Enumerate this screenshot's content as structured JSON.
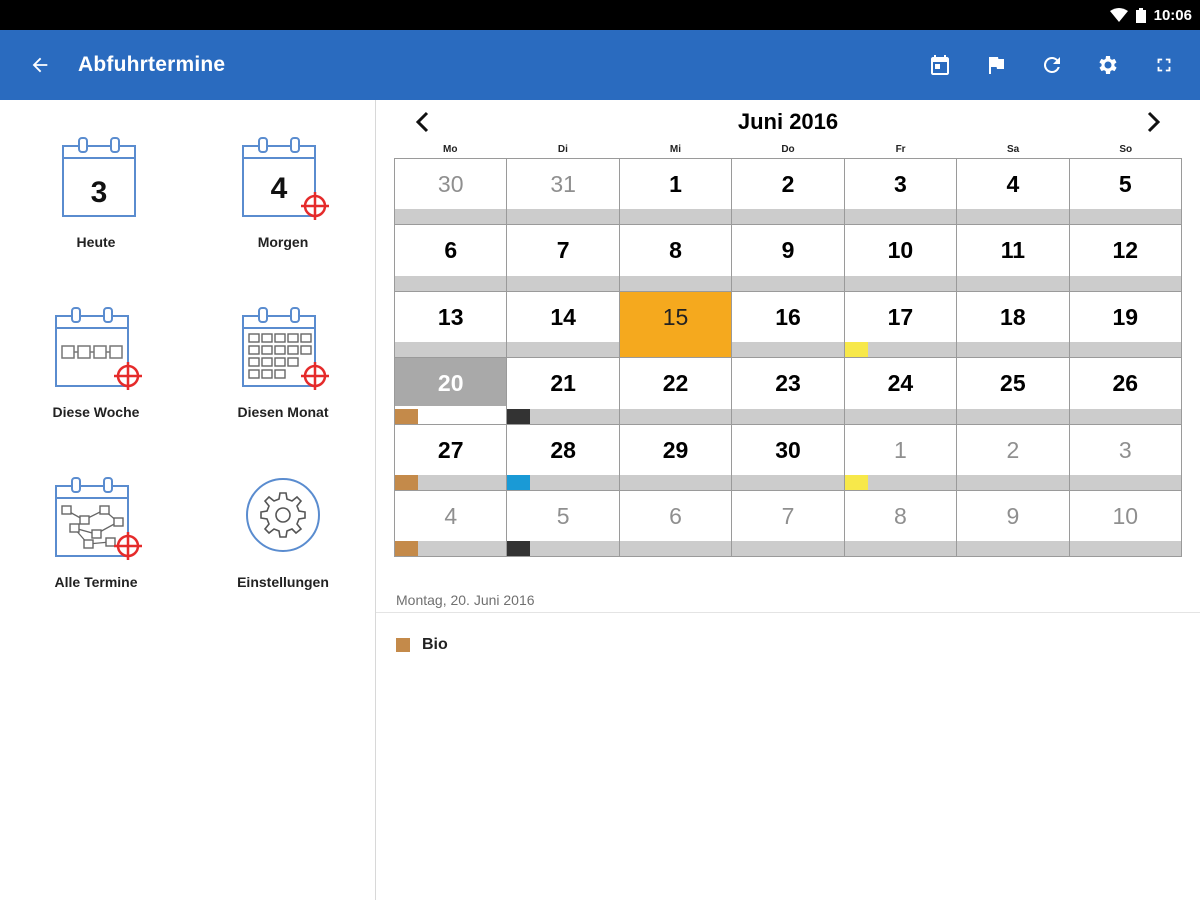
{
  "status_bar": {
    "time": "10:06",
    "icons": [
      "wifi-icon",
      "battery-icon"
    ]
  },
  "app_bar": {
    "title": "Abfuhrtermine",
    "back_icon": "arrow-left-icon",
    "actions": [
      "calendar-today-icon",
      "flag-icon",
      "refresh-icon",
      "settings-icon",
      "fullscreen-icon"
    ]
  },
  "tiles": [
    {
      "id": "today",
      "label": "Heute",
      "number": "3"
    },
    {
      "id": "tomorrow",
      "label": "Morgen",
      "number": "4"
    },
    {
      "id": "week",
      "label": "Diese Woche"
    },
    {
      "id": "month",
      "label": "Diesen Monat"
    },
    {
      "id": "all",
      "label": "Alle Termine"
    },
    {
      "id": "settings",
      "label": "Einstellungen"
    }
  ],
  "calendar": {
    "month_label": "Juni 2016",
    "weekdays": [
      "Mo",
      "Di",
      "Mi",
      "Do",
      "Fr",
      "Sa",
      "So"
    ],
    "colors": {
      "bio": "#c48a4a",
      "rest": "#333333",
      "paper": "#1a9ad6",
      "yellow": "#f7e84a",
      "today": "#f5a91e",
      "selected": "#a9a9a9"
    },
    "days": [
      {
        "d": "30",
        "other": true
      },
      {
        "d": "31",
        "other": true
      },
      {
        "d": "1"
      },
      {
        "d": "2"
      },
      {
        "d": "3"
      },
      {
        "d": "4"
      },
      {
        "d": "5"
      },
      {
        "d": "6"
      },
      {
        "d": "7"
      },
      {
        "d": "8"
      },
      {
        "d": "9"
      },
      {
        "d": "10"
      },
      {
        "d": "11"
      },
      {
        "d": "12"
      },
      {
        "d": "13"
      },
      {
        "d": "14"
      },
      {
        "d": "15",
        "today": true
      },
      {
        "d": "16"
      },
      {
        "d": "17",
        "marker": "yellow"
      },
      {
        "d": "18"
      },
      {
        "d": "19"
      },
      {
        "d": "20",
        "selected": true,
        "marker": "bio"
      },
      {
        "d": "21",
        "marker": "rest"
      },
      {
        "d": "22"
      },
      {
        "d": "23"
      },
      {
        "d": "24"
      },
      {
        "d": "25"
      },
      {
        "d": "26"
      },
      {
        "d": "27",
        "marker": "bio"
      },
      {
        "d": "28",
        "marker": "paper"
      },
      {
        "d": "29"
      },
      {
        "d": "30"
      },
      {
        "d": "1",
        "other": true,
        "marker": "yellow"
      },
      {
        "d": "2",
        "other": true
      },
      {
        "d": "3",
        "other": true
      },
      {
        "d": "4",
        "other": true,
        "marker": "bio"
      },
      {
        "d": "5",
        "other": true,
        "marker": "rest"
      },
      {
        "d": "6",
        "other": true
      },
      {
        "d": "7",
        "other": true
      },
      {
        "d": "8",
        "other": true
      },
      {
        "d": "9",
        "other": true
      },
      {
        "d": "10",
        "other": true
      }
    ]
  },
  "selected_date_label": "Montag, 20. Juni 2016",
  "events": [
    {
      "name": "Bio",
      "color": "#c48a4a"
    }
  ]
}
